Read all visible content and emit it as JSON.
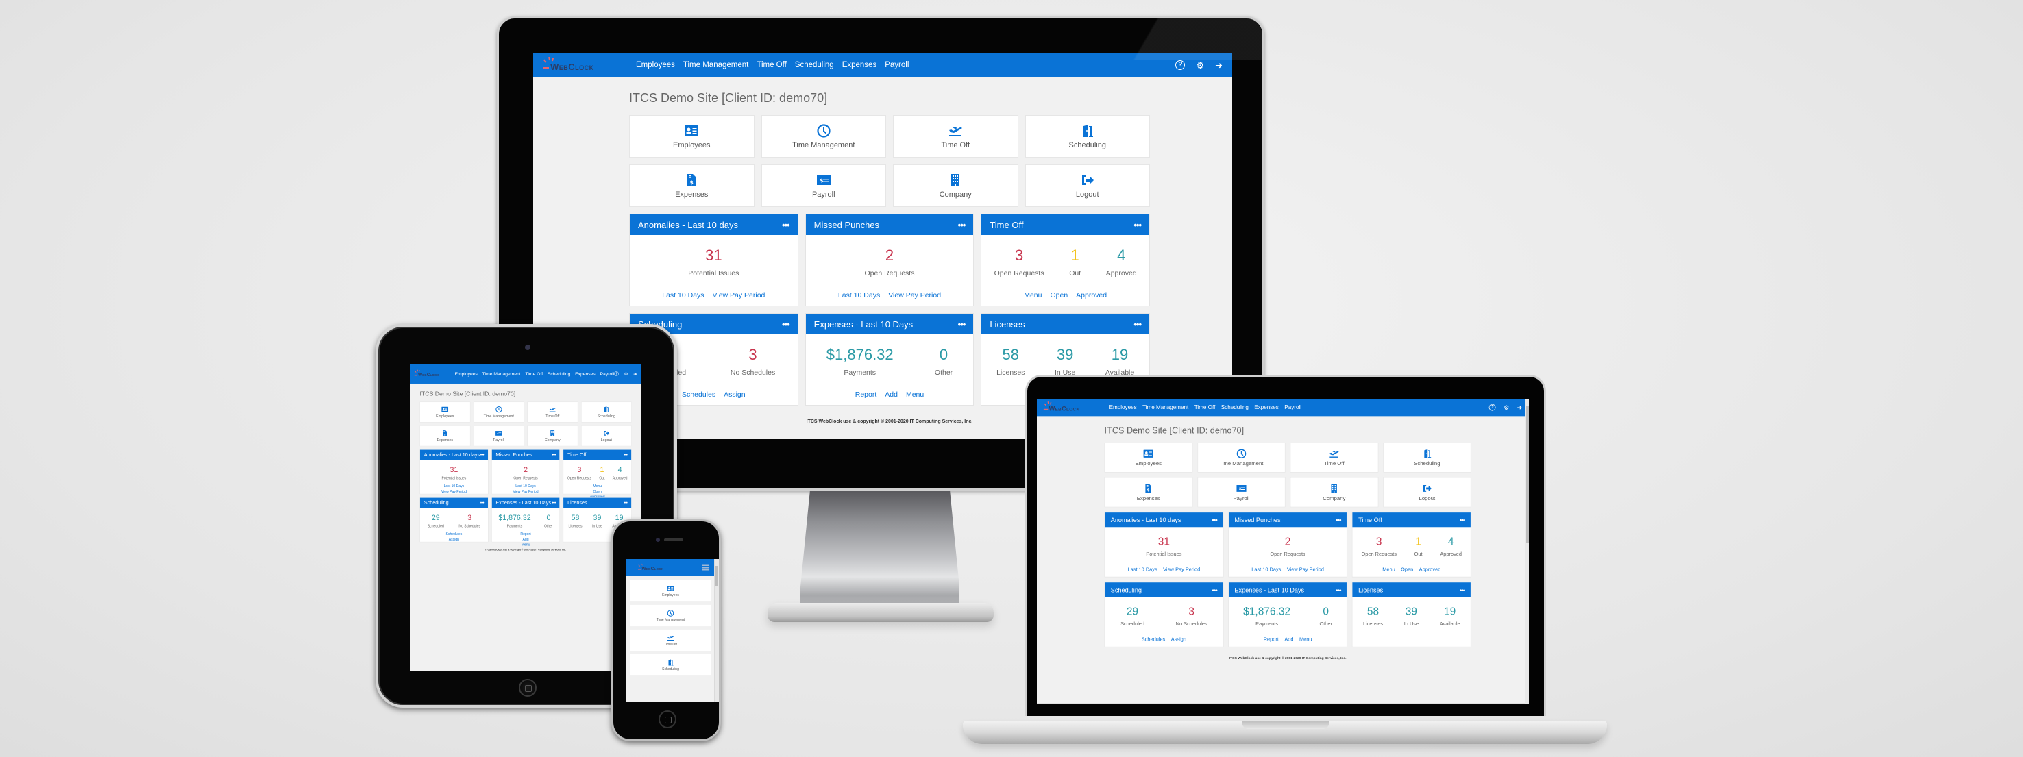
{
  "app": {
    "brand": "WebClock",
    "nav": [
      "Employees",
      "Time Management",
      "Time Off",
      "Scheduling",
      "Expenses",
      "Payroll"
    ],
    "top_icons": [
      "help-icon",
      "gear-icon",
      "logout-icon"
    ],
    "page_title": "ITCS Demo Site [Client ID: demo70]",
    "tiles": [
      {
        "label": "Employees",
        "icon": "id-card-icon"
      },
      {
        "label": "Time Management",
        "icon": "clock-icon"
      },
      {
        "label": "Time Off",
        "icon": "plane-departure-icon"
      },
      {
        "label": "Scheduling",
        "icon": "door-icon"
      },
      {
        "label": "Expenses",
        "icon": "invoice-dollar-icon"
      },
      {
        "label": "Payroll",
        "icon": "money-check-icon"
      },
      {
        "label": "Company",
        "icon": "building-icon"
      },
      {
        "label": "Logout",
        "icon": "sign-out-icon"
      }
    ],
    "widgets": {
      "anomalies": {
        "title": "Anomalies - Last 10 days",
        "stats": [
          {
            "value": "31",
            "label": "Potential Issues"
          }
        ],
        "links": [
          "Last 10 Days",
          "View Pay Period"
        ]
      },
      "missed_punches": {
        "title": "Missed Punches",
        "stats": [
          {
            "value": "2",
            "label": "Open Requests"
          }
        ],
        "links": [
          "Last 10 Days",
          "View Pay Period"
        ]
      },
      "time_off": {
        "title": "Time Off",
        "stats": [
          {
            "value": "3",
            "label": "Open Requests"
          },
          {
            "value": "1",
            "label": "Out"
          },
          {
            "value": "4",
            "label": "Approved"
          }
        ],
        "links": [
          "Menu",
          "Open",
          "Approved"
        ]
      },
      "scheduling": {
        "title": "Scheduling",
        "stats": [
          {
            "value": "29",
            "label": "Scheduled"
          },
          {
            "value": "3",
            "label": "No Schedules"
          }
        ],
        "links": [
          "Schedules",
          "Assign"
        ]
      },
      "expenses": {
        "title": "Expenses - Last 10 Days",
        "stats": [
          {
            "value": "$1,876.32",
            "label": "Payments"
          },
          {
            "value": "0",
            "label": "Other"
          }
        ],
        "links": [
          "Report",
          "Add",
          "Menu"
        ]
      },
      "licenses": {
        "title": "Licenses",
        "stats": [
          {
            "value": "58",
            "label": "Licenses"
          },
          {
            "value": "39",
            "label": "In Use"
          },
          {
            "value": "19",
            "label": "Available"
          }
        ],
        "links": []
      }
    },
    "more_label": "•••",
    "footer": "ITCS WebClock use & copyright © 2001-2020 IT Computing Services, Inc."
  },
  "colors": {
    "brand_blue": "#0a73d6",
    "alert_red": "#c8354e",
    "ok_teal": "#2b9aa6",
    "warn_yellow": "#f2c21c",
    "logo_navy": "#2c3d66",
    "logo_accent": "#e5656f"
  }
}
